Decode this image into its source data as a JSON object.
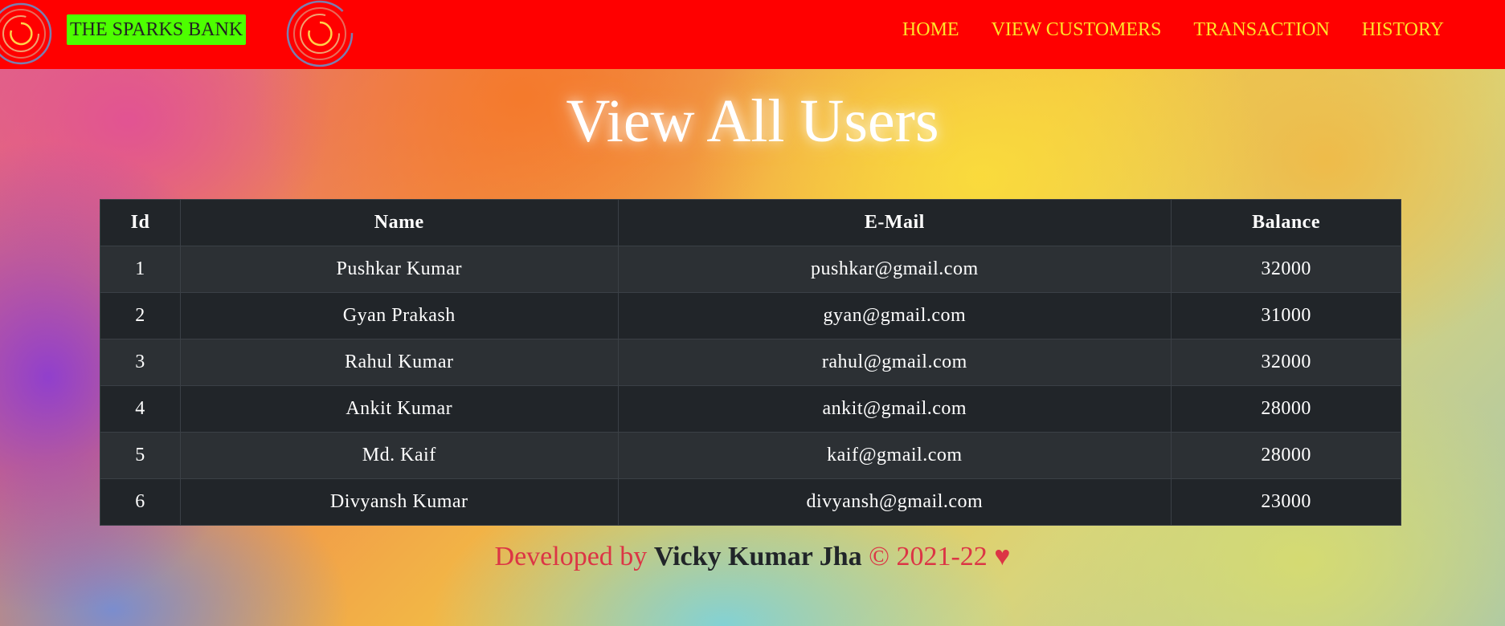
{
  "navbar": {
    "brand": "THE SPARKS BANK",
    "links": [
      "HOME",
      "VIEW CUSTOMERS",
      "TRANSACTION",
      "HISTORY"
    ],
    "background_color": "#ff0000",
    "link_color": "#ffe22a",
    "brand_background": "#4dff00"
  },
  "page": {
    "title": "View All Users"
  },
  "table": {
    "headers": [
      "Id",
      "Name",
      "E-Mail",
      "Balance"
    ],
    "rows": [
      [
        "1",
        "Pushkar Kumar",
        "pushkar@gmail.com",
        "32000"
      ],
      [
        "2",
        "Gyan Prakash",
        "gyan@gmail.com",
        "31000"
      ],
      [
        "3",
        "Rahul Kumar",
        "rahul@gmail.com",
        "32000"
      ],
      [
        "4",
        "Ankit Kumar",
        "ankit@gmail.com",
        "28000"
      ],
      [
        "5",
        "Md. Kaif",
        "kaif@gmail.com",
        "28000"
      ],
      [
        "6",
        "Divyansh Kumar",
        "divyansh@gmail.com",
        "23000"
      ]
    ]
  },
  "footer": {
    "prefix": "Developed by",
    "author": "Vicky Kumar Jha",
    "suffix": "© 2021-22 ♥"
  }
}
